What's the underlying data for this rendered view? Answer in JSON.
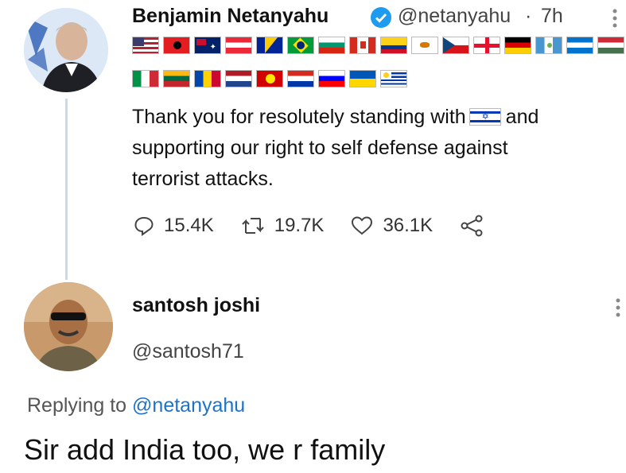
{
  "tweet": {
    "author_name": "Benjamin Netanyahu",
    "author_handle": "@netanyahu",
    "separator": "·",
    "time": "7h",
    "flags_row1": [
      "united-states",
      "albania",
      "australia",
      "austria",
      "bosnia",
      "brazil",
      "bulgaria",
      "canada",
      "colombia",
      "cyprus",
      "czech-republic",
      "georgia",
      "germany",
      "guatemala",
      "honduras",
      "hungary"
    ],
    "flags_row2": [
      "italy",
      "lithuania",
      "moldova",
      "netherlands",
      "north-macedonia",
      "paraguay",
      "slovenia",
      "ukraine",
      "uruguay"
    ],
    "text_line1_before_flag": "Thank you for resolutely standing with",
    "text_line1_after_flag": "and",
    "text_line2": "supporting our right to self defense against",
    "text_line3": "terrorist attacks.",
    "replies": "15.4K",
    "retweets": "19.7K",
    "likes": "36.1K"
  },
  "reply": {
    "author_name": "santosh joshi",
    "author_handle": "@santosh71",
    "replying_prefix": "Replying to",
    "replying_handle": "@netanyahu",
    "text": "Sir add India too, we r family"
  },
  "colors": {
    "link_blue": "#1d73c9",
    "verified_blue": "#1d9bf0",
    "thread_line": "#cfd9de"
  }
}
